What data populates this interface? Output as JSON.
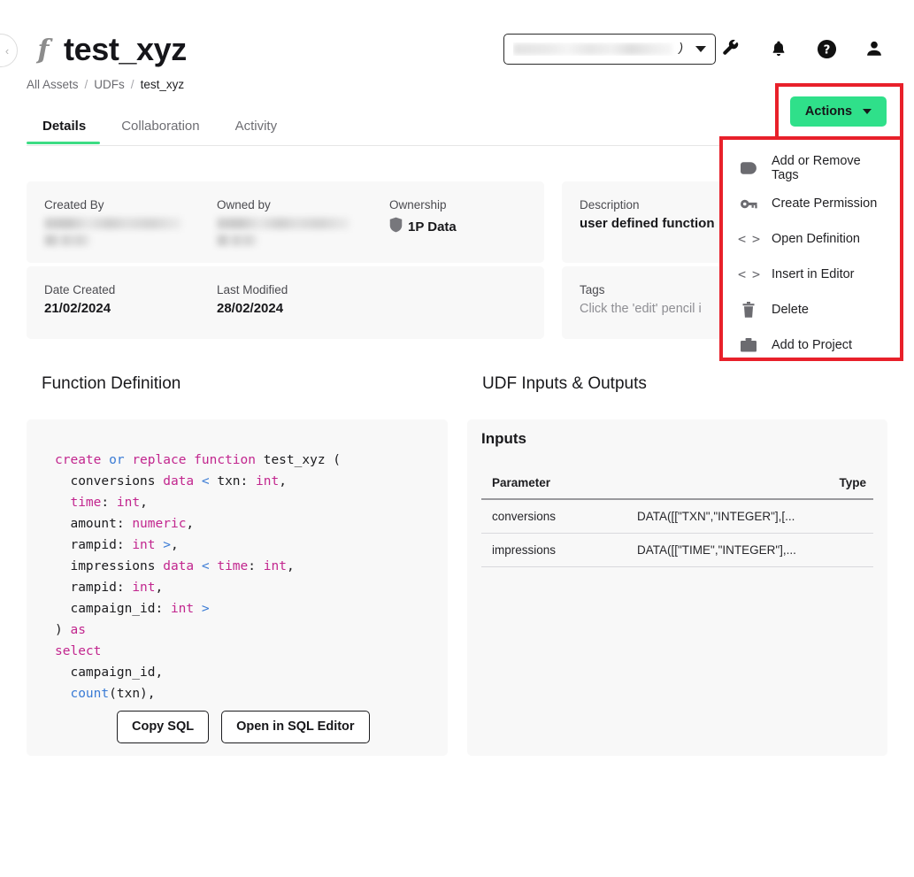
{
  "header": {
    "title": "test_xyz",
    "function_glyph": "f",
    "back_icon": "chevron-left-icon",
    "breadcrumb": [
      {
        "label": "All Assets",
        "current": false
      },
      {
        "label": "UDFs",
        "current": false
      },
      {
        "label": "test_xyz",
        "current": true
      }
    ],
    "separator": "/",
    "context_select": {
      "value_redacted": true,
      "value_suffix": ")",
      "caret_icon": "chevron-down-icon"
    },
    "icons": [
      {
        "name": "wrench-icon"
      },
      {
        "name": "bell-icon"
      },
      {
        "name": "help-circle-icon"
      },
      {
        "name": "user-account-icon"
      }
    ]
  },
  "tabs": [
    {
      "label": "Details",
      "active": true
    },
    {
      "label": "Collaboration",
      "active": false
    },
    {
      "label": "Activity",
      "active": false
    }
  ],
  "info_cards": {
    "created_by": {
      "label": "Created By",
      "value_redacted": true
    },
    "owned_by": {
      "label": "Owned by",
      "value_redacted": true
    },
    "ownership": {
      "label": "Ownership",
      "value": "1P Data",
      "icon": "shield-icon"
    },
    "date_created": {
      "label": "Date Created",
      "value": "21/02/2024"
    },
    "last_modified": {
      "label": "Last Modified",
      "value": "28/02/2024"
    },
    "description": {
      "label": "Description",
      "value": "user defined function"
    },
    "tags": {
      "label": "Tags",
      "value": "Click the 'edit' pencil i"
    }
  },
  "sections": {
    "function_definition": "Function Definition",
    "udf_inputs_outputs": "UDF Inputs & Outputs"
  },
  "code": {
    "lines": [
      [
        [
          "create ",
          "k-pink"
        ],
        [
          "or ",
          "k-blue"
        ],
        [
          "replace function ",
          "k-pink"
        ],
        [
          "test_xyz (",
          "k-plain"
        ]
      ],
      [
        [
          "  conversions ",
          "k-plain"
        ],
        [
          "data ",
          "k-pink"
        ],
        [
          "< ",
          "k-blue"
        ],
        [
          "txn: ",
          "k-plain"
        ],
        [
          "int",
          "k-pink"
        ],
        [
          ",",
          "k-plain"
        ]
      ],
      [
        [
          "  time",
          "k-pink"
        ],
        [
          ": ",
          "k-plain"
        ],
        [
          "int",
          "k-pink"
        ],
        [
          ",",
          "k-plain"
        ]
      ],
      [
        [
          "  amount: ",
          "k-plain"
        ],
        [
          "numeric",
          "k-pink"
        ],
        [
          ",",
          "k-plain"
        ]
      ],
      [
        [
          "  rampid: ",
          "k-plain"
        ],
        [
          "int ",
          "k-pink"
        ],
        [
          ">",
          "k-blue"
        ],
        [
          ",",
          "k-plain"
        ]
      ],
      [
        [
          "  impressions ",
          "k-plain"
        ],
        [
          "data ",
          "k-pink"
        ],
        [
          "< ",
          "k-blue"
        ],
        [
          "time",
          "k-pink"
        ],
        [
          ": ",
          "k-plain"
        ],
        [
          "int",
          "k-pink"
        ],
        [
          ",",
          "k-plain"
        ]
      ],
      [
        [
          "  rampid: ",
          "k-plain"
        ],
        [
          "int",
          "k-pink"
        ],
        [
          ",",
          "k-plain"
        ]
      ],
      [
        [
          "  campaign_id: ",
          "k-plain"
        ],
        [
          "int ",
          "k-pink"
        ],
        [
          ">",
          "k-blue"
        ]
      ],
      [
        [
          ") ",
          "k-plain"
        ],
        [
          "as",
          "k-pink"
        ]
      ],
      [
        [
          "select",
          "k-pink"
        ]
      ],
      [
        [
          "  campaign_id,",
          "k-plain"
        ]
      ],
      [
        [
          "  ",
          "k-plain"
        ],
        [
          "count",
          "k-blue"
        ],
        [
          "(txn),",
          "k-plain"
        ]
      ]
    ],
    "buttons": [
      {
        "label": "Copy SQL",
        "name": "copy-sql-button"
      },
      {
        "label": "Open in SQL Editor",
        "name": "open-in-sql-editor-button"
      }
    ]
  },
  "inputs_panel": {
    "title": "Inputs",
    "columns": [
      "Parameter",
      "Type"
    ],
    "rows": [
      {
        "parameter": "conversions",
        "type": "DATA([[\"TXN\",\"INTEGER\"],[..."
      },
      {
        "parameter": "impressions",
        "type": "DATA([[\"TIME\",\"INTEGER\"],..."
      }
    ]
  },
  "actions": {
    "button_label": "Actions",
    "caret_icon": "chevron-down-icon",
    "menu": [
      {
        "label": "Add or Remove Tags",
        "icon": "tag-icon",
        "name": "menu-add-or-remove-tags"
      },
      {
        "label": "Create Permission",
        "icon": "key-icon",
        "name": "menu-create-permission"
      },
      {
        "label": "Open Definition",
        "icon": "code-brackets-icon",
        "name": "menu-open-definition"
      },
      {
        "label": "Insert in Editor",
        "icon": "code-brackets-icon",
        "name": "menu-insert-in-editor"
      },
      {
        "label": "Delete",
        "icon": "trash-icon",
        "name": "menu-delete"
      },
      {
        "label": "Add to Project",
        "icon": "briefcase-icon",
        "name": "menu-add-to-project"
      }
    ]
  },
  "colors": {
    "accent_green": "#2fe08a",
    "highlight_red": "#e8202a",
    "card_bg": "#f8f8f8",
    "code_keyword": "#c2268e",
    "code_function": "#3a7bd5"
  }
}
